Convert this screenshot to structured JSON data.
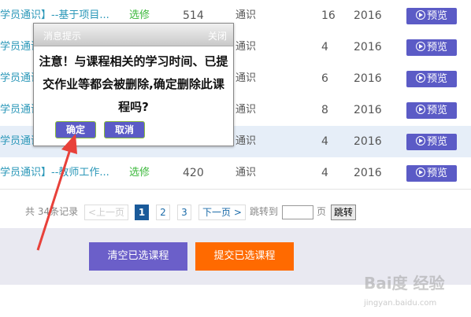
{
  "rows": [
    {
      "title": "学员通识】--基于项目...",
      "type": "选修",
      "hours": "514",
      "category": "通识",
      "credit": "16",
      "year": "2016",
      "preview": "预览"
    },
    {
      "title": "学员通识】",
      "type": "",
      "hours": "",
      "category": "通识",
      "credit": "4",
      "year": "2016",
      "preview": "预览"
    },
    {
      "title": "学员通识】",
      "type": "",
      "hours": "",
      "category": "通识",
      "credit": "6",
      "year": "2016",
      "preview": "预览"
    },
    {
      "title": "学员通识】",
      "type": "",
      "hours": "",
      "category": "通识",
      "credit": "8",
      "year": "2016",
      "preview": "预览"
    },
    {
      "title": "学员通识】",
      "type": "",
      "hours": "",
      "category": "通识",
      "credit": "4",
      "year": "2016",
      "preview": "预览"
    },
    {
      "title": "学员通识】--教师工作...",
      "type": "选修",
      "hours": "420",
      "category": "通识",
      "credit": "4",
      "year": "2016",
      "preview": "预览"
    }
  ],
  "pager": {
    "total": "共 34条记录",
    "prev": "<上一页",
    "pages": [
      "1",
      "2",
      "3"
    ],
    "next": "下一页 >",
    "jump_label": "跳转到",
    "jump_value": "",
    "page_unit": "页",
    "go": "跳转"
  },
  "actions": {
    "clear": "清空已选课程",
    "submit": "提交已选课程"
  },
  "dialog": {
    "title": "消息提示",
    "close": "关闭",
    "message": "注意！与课程相关的学习时间、已提交作业等都会被删除,确定删除此课程吗?",
    "ok": "确定",
    "cancel": "取消"
  },
  "watermark": {
    "brand": "Bai度 经验",
    "url": "jingyan.baidu.com"
  },
  "colors": {
    "accent": "#5b5bc6",
    "submit": "#ff6a00",
    "link": "#2a97b8",
    "elective": "#3cb83c"
  }
}
